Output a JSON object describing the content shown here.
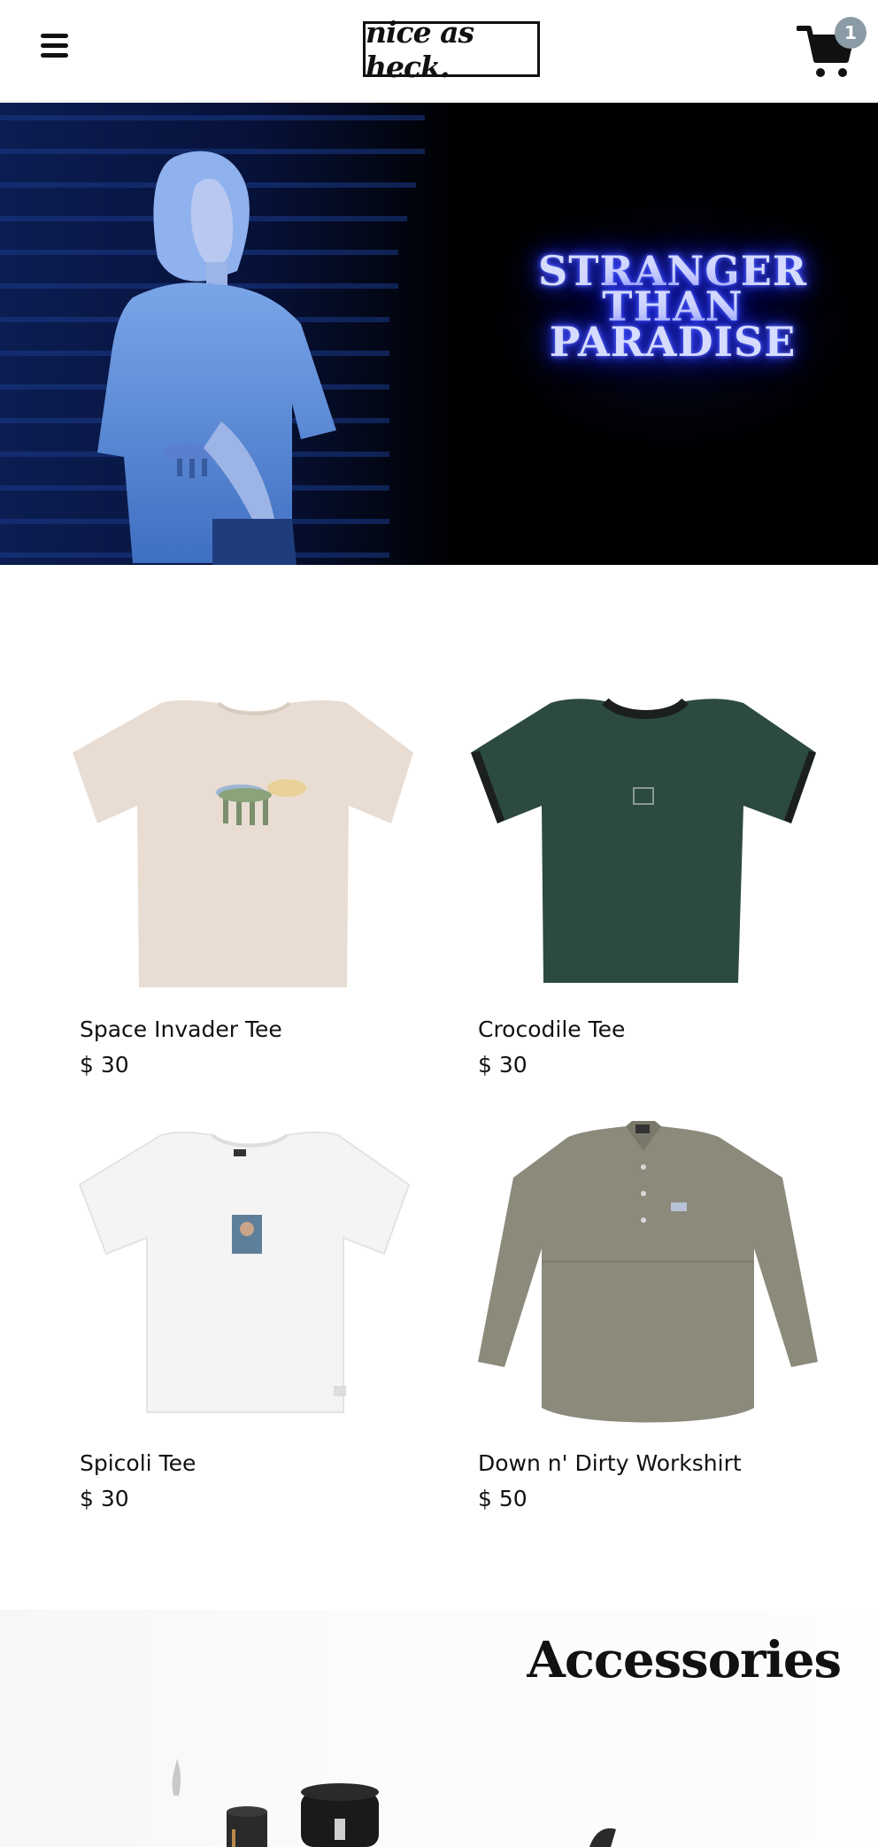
{
  "header": {
    "menu_icon": "hamburger-menu-icon",
    "logo_text": "nice as heck.",
    "cart_icon": "shopping-cart-icon",
    "cart_count": "1",
    "colors": {
      "badge": "#8a9ba5"
    }
  },
  "hero": {
    "neon_lines": [
      "STRANGER",
      "THAN",
      "PARADISE"
    ],
    "colors": {
      "neon": "#3c48ff",
      "background": "#000000"
    }
  },
  "products": [
    {
      "name": "Space Invader Tee",
      "price": "$ 30",
      "image": "cream-tshirt-image"
    },
    {
      "name": "Crocodile Tee",
      "price": "$ 30",
      "image": "green-tshirt-image"
    },
    {
      "name": "Spicoli Tee",
      "price": "$ 30",
      "image": "white-tshirt-image"
    },
    {
      "name": "Down n' Dirty Workshirt",
      "price": "$ 50",
      "image": "khaki-workshirt-image"
    }
  ],
  "accessories": {
    "title": "Accessories"
  }
}
